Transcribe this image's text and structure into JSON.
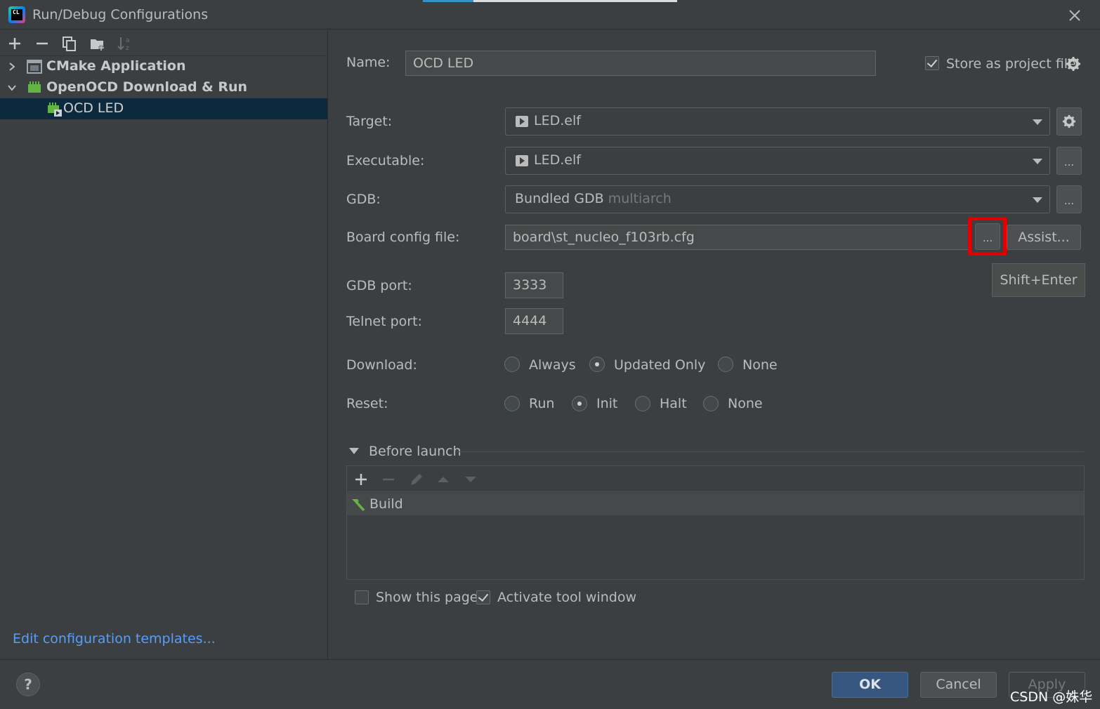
{
  "window": {
    "title": "Run/Debug Configurations",
    "logo_text": "CL"
  },
  "tree": {
    "items": [
      {
        "label": "CMake Application",
        "expanded": false
      },
      {
        "label": "OpenOCD Download & Run",
        "expanded": true
      },
      {
        "label": "OCD LED",
        "selected": true
      }
    ],
    "edit_templates_link": "Edit configuration templates..."
  },
  "form": {
    "name_label": "Name:",
    "name_value": "OCD LED",
    "store_label": "Store as project file",
    "store_checked": true,
    "target_label": "Target:",
    "target_value": "LED.elf",
    "executable_label": "Executable:",
    "executable_value": "LED.elf",
    "gdb_label": "GDB:",
    "gdb_value": "Bundled GDB",
    "gdb_hint": "multiarch",
    "board_label": "Board config file:",
    "board_value": "board\\st_nucleo_f103rb.cfg",
    "browse_label": "...",
    "assist_label": "Assist...",
    "tooltip": "Shift+Enter",
    "gdb_port_label": "GDB port:",
    "gdb_port_value": "3333",
    "telnet_port_label": "Telnet port:",
    "telnet_port_value": "4444",
    "download_label": "Download:",
    "download_options": [
      "Always",
      "Updated Only",
      "None"
    ],
    "download_selected": "Updated Only",
    "reset_label": "Reset:",
    "reset_options": [
      "Run",
      "Init",
      "Halt",
      "None"
    ],
    "reset_selected": "Init"
  },
  "before_launch": {
    "title": "Before launch",
    "tasks": [
      "Build"
    ],
    "show_page_label": "Show this page",
    "show_page_checked": false,
    "activate_label": "Activate tool window",
    "activate_checked": true
  },
  "buttons": {
    "help": "?",
    "ok": "OK",
    "cancel": "Cancel",
    "apply": "Apply"
  },
  "watermark": "CSDN @姝华",
  "colors": {
    "background": "#3c3f41",
    "selection": "#0d293e",
    "link": "#589df6",
    "primary_button": "#365880",
    "highlight_box": "#e00000"
  }
}
